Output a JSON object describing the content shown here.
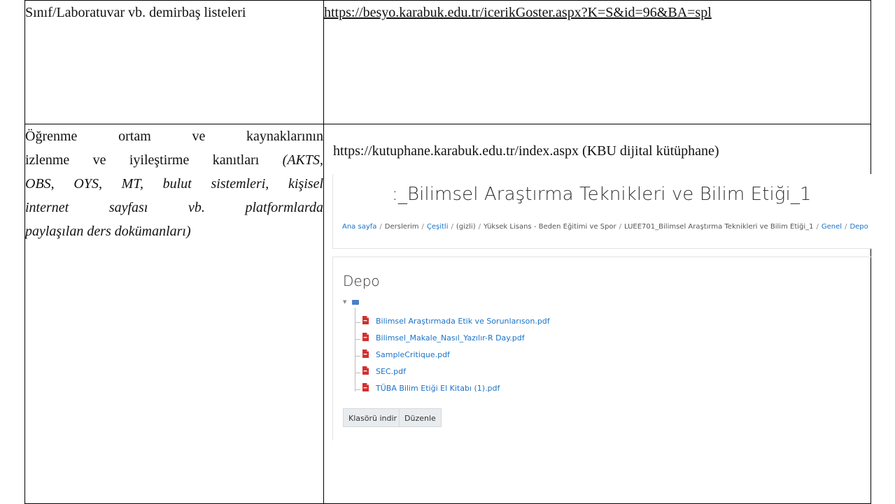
{
  "row1": {
    "left_text": "Sınıf/Laboratuvar vb. demirbaş listeleri",
    "right_link": "https://besyo.karabuk.edu.tr/icerikGoster.aspx?K=S&id=96&BA=spl"
  },
  "row2": {
    "left_line1": "Öğrenme ortam ve kaynaklarının",
    "left_line2_normal": "izlenme ve iyileştirme kanıtları ",
    "left_line2_italic": "(AKTS,",
    "left_line3": "OBS, OYS, MT, bulut sistemleri, kişisel",
    "left_line4": "internet sayfası vb. platformlarda",
    "left_line5": "paylaşılan ders dokümanları)",
    "right_text": "https://kutuphane.karabuk.edu.tr/index.aspx (KBU dijital kütüphane)"
  },
  "screenshot": {
    "course_title": ":_Bilimsel Araştırma Teknikleri ve Bilim Etiği_1",
    "breadcrumb": [
      {
        "label": "Ana sayfa",
        "link": true
      },
      {
        "label": "Derslerim",
        "link": false
      },
      {
        "label": "Çeşitli",
        "link": true
      },
      {
        "label": "(gizli)",
        "link": false
      },
      {
        "label": "Yüksek Lisans - Beden Eğitimi ve Spor",
        "link": false
      },
      {
        "label": "LUEE701_Bilimsel Araştırma Teknikleri ve Bilim Etiği_1",
        "link": false
      },
      {
        "label": "Genel",
        "link": true
      },
      {
        "label": "Depo",
        "link": true
      }
    ],
    "section_title": "Depo",
    "files": [
      "Bilimsel Araştırmada Etik ve Sorunlarıson.pdf",
      "Bilimsel_Makale_Nasıl_Yazılır-R Day.pdf",
      "SampleCritique.pdf",
      "SEC.pdf",
      "TÜBA Bilim Etiği El Kitabı (1).pdf"
    ],
    "download_button": "Klasörü indir",
    "edit_button": "Düzenle",
    "colors": {
      "link": "#1a73c8",
      "pdf_icon": "#d32f2f",
      "folder_icon": "#4a7fc9"
    }
  }
}
